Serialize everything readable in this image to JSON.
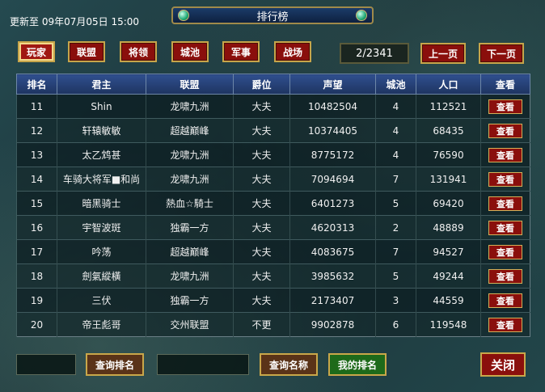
{
  "header": {
    "updated_text": "更新至 09年07月05日 15:00",
    "title": "排行榜"
  },
  "tabs": [
    {
      "label": "玩家",
      "active": true
    },
    {
      "label": "联盟",
      "active": false
    },
    {
      "label": "将领",
      "active": false
    },
    {
      "label": "城池",
      "active": false
    },
    {
      "label": "军事",
      "active": false
    },
    {
      "label": "战场",
      "active": false
    }
  ],
  "pagination": {
    "page_indicator": "2/2341",
    "prev_label": "上一页",
    "next_label": "下一页"
  },
  "table": {
    "columns": [
      "排名",
      "君主",
      "联盟",
      "爵位",
      "声望",
      "城池",
      "人口",
      "查看"
    ],
    "view_label": "查看",
    "rows": [
      {
        "rank": "11",
        "lord": "Shin",
        "alliance": "龙啸九洲",
        "title": "大夫",
        "prestige": "10482504",
        "cities": "4",
        "population": "112521"
      },
      {
        "rank": "12",
        "lord": "轩辕敏敏",
        "alliance": "超越巅峰",
        "title": "大夫",
        "prestige": "10374405",
        "cities": "4",
        "population": "68435"
      },
      {
        "rank": "13",
        "lord": "太乙鸩甚",
        "alliance": "龙啸九洲",
        "title": "大夫",
        "prestige": "8775172",
        "cities": "4",
        "population": "76590"
      },
      {
        "rank": "14",
        "lord": "车骑大将军■和尚",
        "alliance": "龙啸九洲",
        "title": "大夫",
        "prestige": "7094694",
        "cities": "7",
        "population": "131941"
      },
      {
        "rank": "15",
        "lord": "暗黑骑士",
        "alliance": "熱血☆騎士",
        "title": "大夫",
        "prestige": "6401273",
        "cities": "5",
        "population": "69420"
      },
      {
        "rank": "16",
        "lord": "宇智波斑",
        "alliance": "独霸一方",
        "title": "大夫",
        "prestige": "4620313",
        "cities": "2",
        "population": "48889"
      },
      {
        "rank": "17",
        "lord": "吟荡",
        "alliance": "超越巅峰",
        "title": "大夫",
        "prestige": "4083675",
        "cities": "7",
        "population": "94527"
      },
      {
        "rank": "18",
        "lord": "劍氣縱橫",
        "alliance": "龙啸九洲",
        "title": "大夫",
        "prestige": "3985632",
        "cities": "5",
        "population": "49244"
      },
      {
        "rank": "19",
        "lord": "三伏",
        "alliance": "独霸一方",
        "title": "大夫",
        "prestige": "2173407",
        "cities": "3",
        "population": "44559"
      },
      {
        "rank": "20",
        "lord": "帝王彪哥",
        "alliance": "交州联盟",
        "title": "不更",
        "prestige": "9902878",
        "cities": "6",
        "population": "119548"
      }
    ]
  },
  "footer": {
    "query_rank_label": "查询排名",
    "query_name_label": "查询名称",
    "my_rank_label": "我的排名",
    "close_label": "关闭"
  }
}
